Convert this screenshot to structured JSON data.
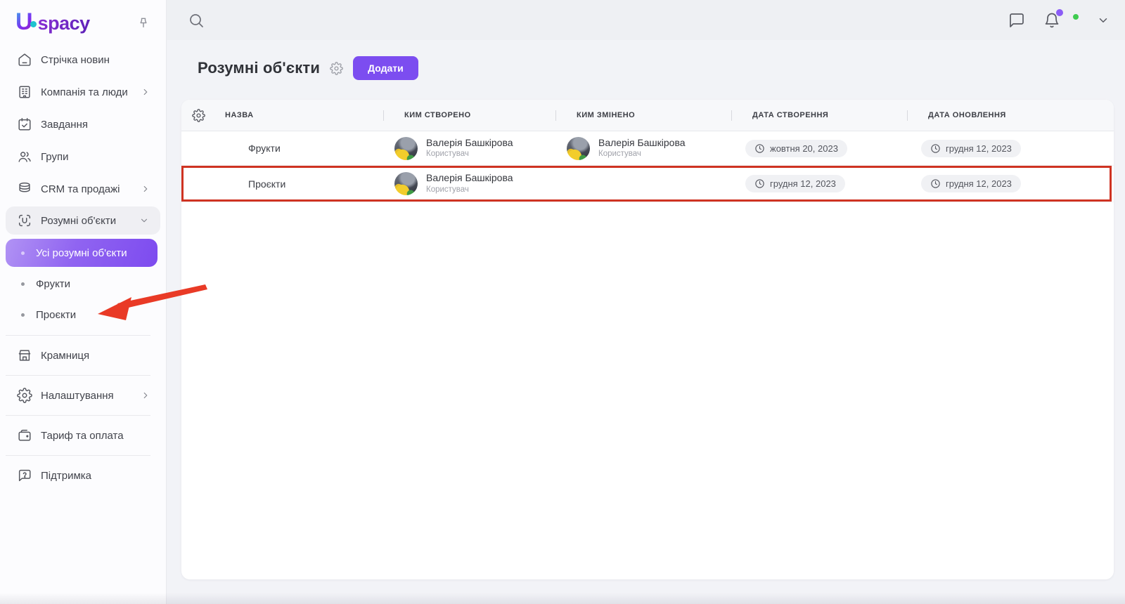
{
  "brand": {
    "logo_u": "U",
    "logo_rest": "spacy"
  },
  "sidebar": {
    "items": [
      {
        "label": "Стрічка новин"
      },
      {
        "label": "Компанія та люди"
      },
      {
        "label": "Завдання"
      },
      {
        "label": "Групи"
      },
      {
        "label": "CRM та продажі"
      },
      {
        "label": "Розумні об'єкти"
      }
    ],
    "subitems": [
      {
        "label": "Усі розумні об'єкти",
        "selected": true
      },
      {
        "label": "Фрукти",
        "selected": false
      },
      {
        "label": "Проєкти",
        "selected": false
      }
    ],
    "bottom_items": [
      {
        "label": "Крамниця"
      },
      {
        "label": "Налаштування"
      },
      {
        "label": "Тариф та оплата"
      },
      {
        "label": "Підтримка"
      }
    ]
  },
  "page": {
    "title": "Розумні об'єкти",
    "add_button_label": "Додати"
  },
  "table": {
    "columns": [
      "НАЗВА",
      "КИМ СТВОРЕНО",
      "КИМ ЗМІНЕНО",
      "ДАТА СТВОРЕННЯ",
      "ДАТА ОНОВЛЕННЯ"
    ],
    "rows": [
      {
        "name": "Фрукти",
        "created_by": {
          "name": "Валерія Башкірова",
          "role": "Користувач"
        },
        "modified_by": {
          "name": "Валерія Башкірова",
          "role": "Користувач"
        },
        "created_at": "жовтня 20, 2023",
        "updated_at": "грудня 12, 2023",
        "highlighted": false
      },
      {
        "name": "Проєкти",
        "created_by": {
          "name": "Валерія Башкірова",
          "role": "Користувач"
        },
        "modified_by": null,
        "created_at": "грудня 12, 2023",
        "updated_at": "грудня 12, 2023",
        "highlighted": true
      }
    ]
  },
  "colors": {
    "accent": "#7c4df0",
    "highlight_border": "#cf3322",
    "annotation_arrow": "#e93a26",
    "online_status": "#3ecb4f",
    "notification_dot": "#8b5cf6"
  }
}
